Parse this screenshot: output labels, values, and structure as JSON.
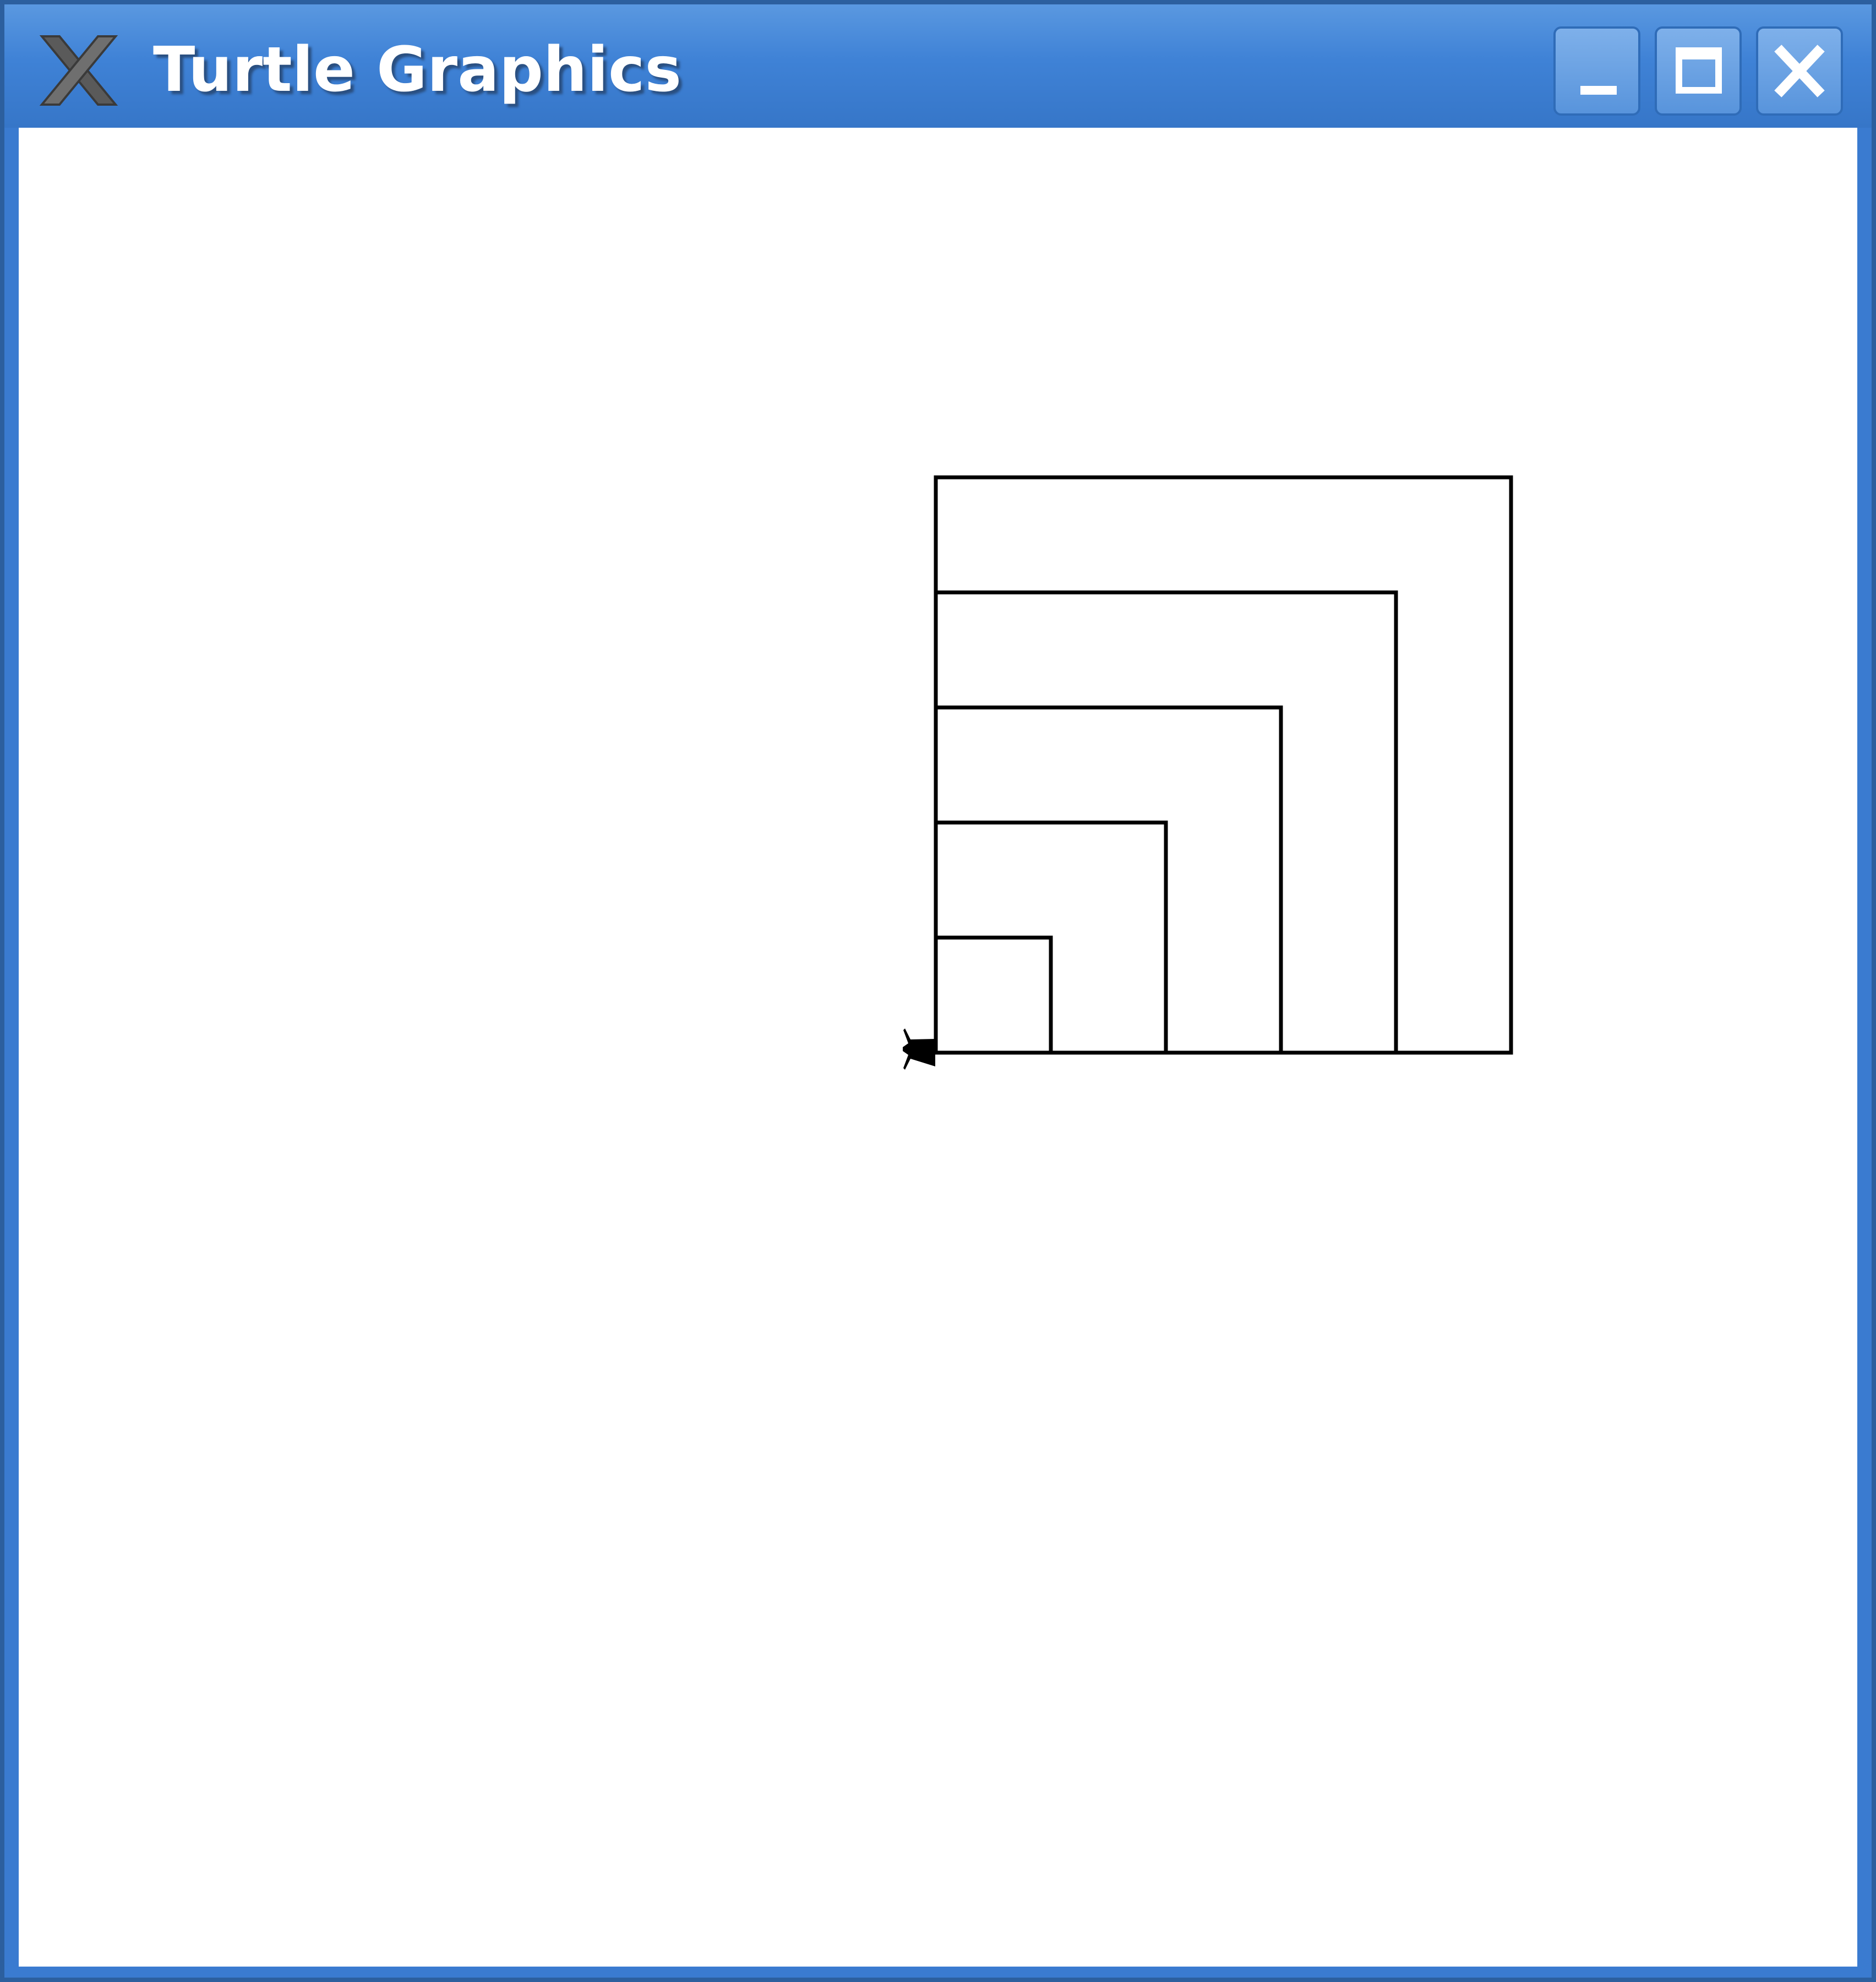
{
  "window": {
    "title": "Turtle Graphics",
    "app_icon": "x-logo-icon",
    "buttons": [
      {
        "name": "minimize-button",
        "icon": "minimize-icon"
      },
      {
        "name": "maximize-button",
        "icon": "maximize-icon"
      },
      {
        "name": "close-button",
        "icon": "close-icon"
      }
    ]
  },
  "canvas": {
    "background": "#ffffff",
    "stroke": "#000000",
    "turtle_icon": "turtle-cursor-icon",
    "squares": [
      {
        "side": 1
      },
      {
        "side": 2
      },
      {
        "side": 3
      },
      {
        "side": 4
      },
      {
        "side": 5
      }
    ]
  }
}
